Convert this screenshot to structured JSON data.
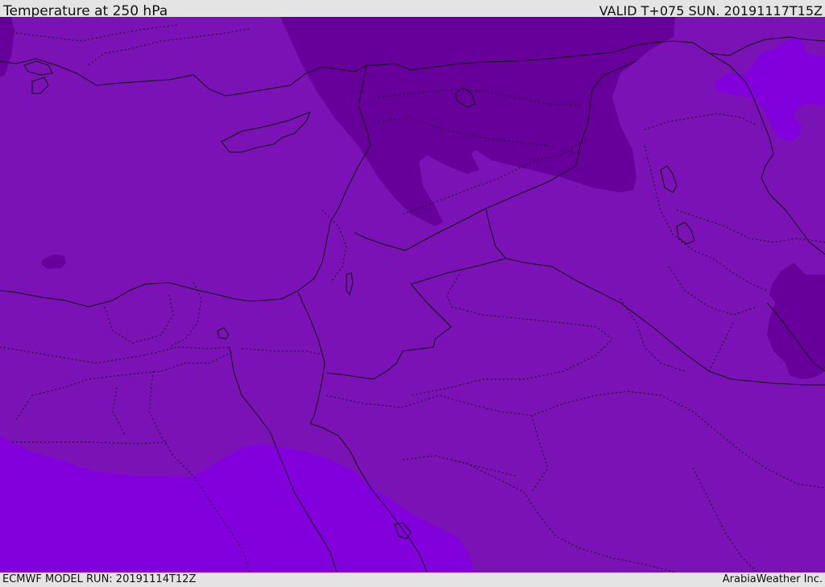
{
  "header": {
    "title": "Temperature at 250 hPa",
    "valid_time": "VALID T+075 SUN. 20191117T15Z"
  },
  "footer": {
    "model_run": "ECMWF MODEL RUN: 20191114T12Z",
    "credit": "ArabiaWeather Inc."
  },
  "colors": {
    "background_band": "#7a12b6",
    "colder_band": "#67009a",
    "warmer_band": "#8200dc",
    "border_line": "#111111",
    "header_bg": "#e4e4e4"
  }
}
